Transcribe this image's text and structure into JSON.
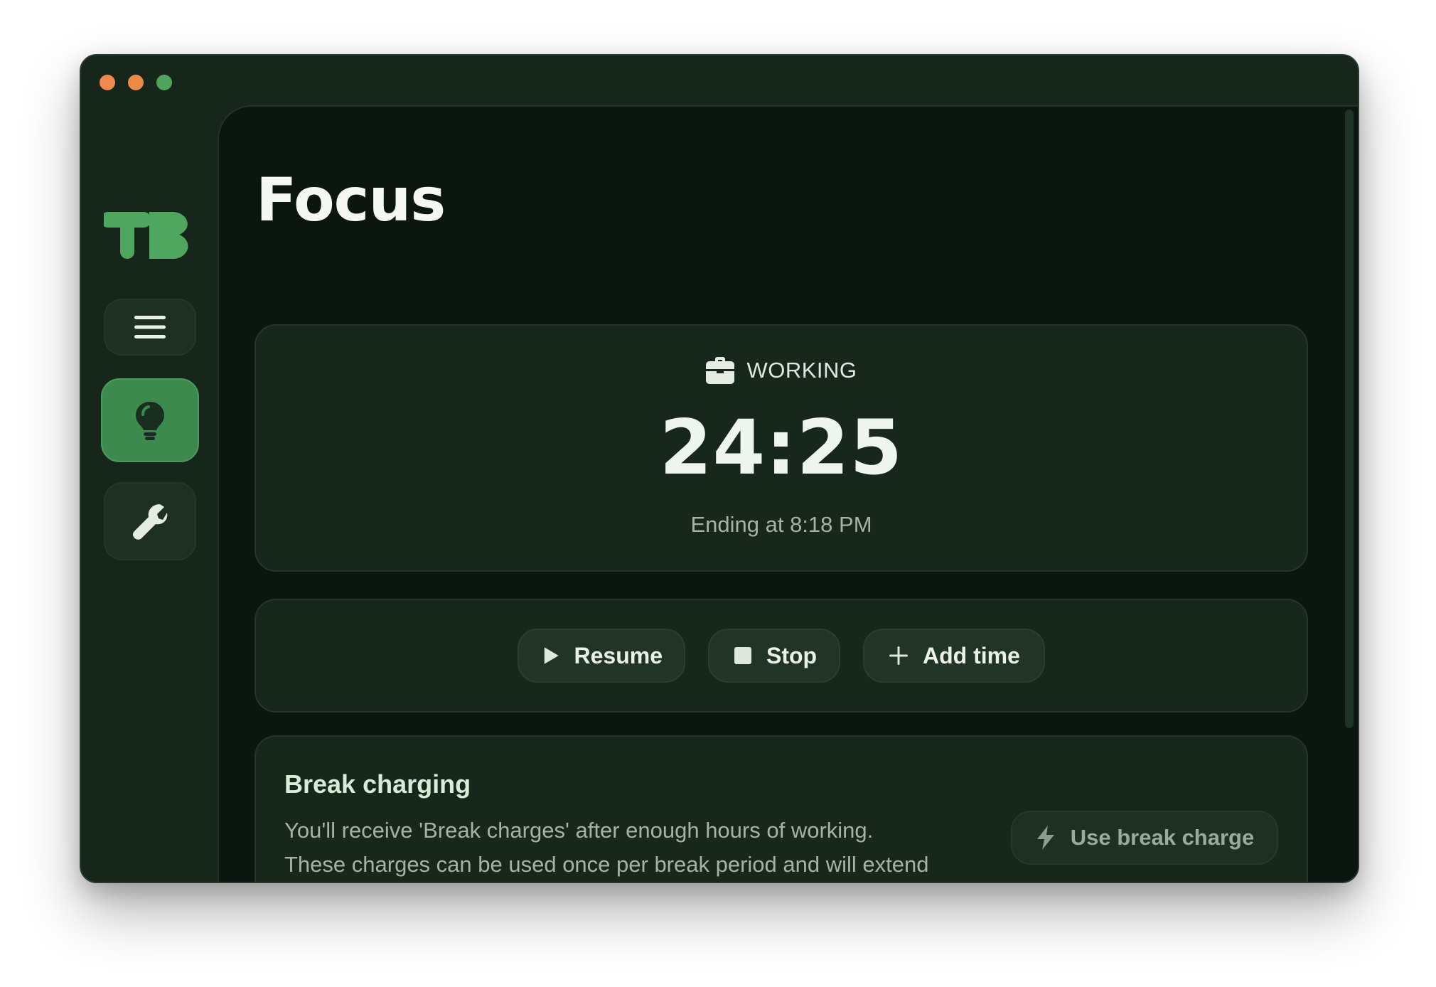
{
  "window": {
    "colors": {
      "accent": "#3d8a4e",
      "background": "#0b1610",
      "sidebar": "#17261b"
    }
  },
  "sidebar": {
    "logo_text": "TB",
    "items": [
      {
        "icon": "menu-icon",
        "active": false
      },
      {
        "icon": "lightbulb-icon",
        "active": true
      },
      {
        "icon": "wrench-icon",
        "active": false
      }
    ]
  },
  "page": {
    "title": "Focus"
  },
  "timer": {
    "status_icon": "briefcase-icon",
    "status": "WORKING",
    "time": "24:25",
    "ending": "Ending at 8:18 PM"
  },
  "controls": {
    "resume": "Resume",
    "stop": "Stop",
    "add_time": "Add time"
  },
  "break_charging": {
    "title": "Break charging",
    "description": "You'll receive 'Break charges' after enough hours of working. These charges can be used once per break period and will extend them by a few minutes as a reward for working hard!",
    "button": "Use break charge",
    "button_icon": "lightning-icon"
  }
}
